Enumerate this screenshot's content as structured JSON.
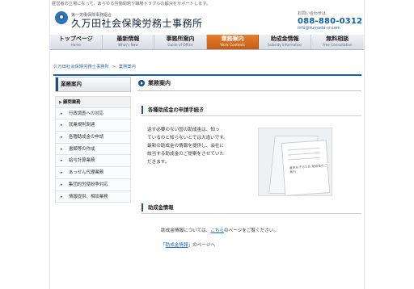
{
  "header": {
    "tagline": "経営者の立場になって、あらゆる労働問題や職場トラブルの解決をサポートします。",
    "logo_subtitle": "第一労働保険事務組合",
    "logo_title": "久万田社会保険労務士事務所",
    "contact_label": "お問い合わせは",
    "phone": "088-880-0312",
    "email": "info@kumada-sr.com"
  },
  "nav": {
    "items": [
      {
        "label": "トップページ",
        "en": "Home"
      },
      {
        "label": "最新情報",
        "en": "What's New"
      },
      {
        "label": "事務所案内",
        "en": "Guide of Office"
      },
      {
        "label": "業務案内",
        "en": "Work Contents"
      },
      {
        "label": "助成金情報",
        "en": "Subsidy Information"
      },
      {
        "label": "無料相談",
        "en": "Free Consultation"
      }
    ],
    "active": "業務案内"
  },
  "breadcrumb": {
    "home": "久万田社会保険労務士事務所",
    "separator": ">",
    "current": "業務案内"
  },
  "sidebar": {
    "title": "業務案内",
    "items": [
      {
        "label": "顧問業務"
      },
      {
        "label": "行政調査への対応"
      },
      {
        "label": "就業規則関連"
      },
      {
        "label": "各種助成金の申請"
      },
      {
        "label": "書類等の作成"
      },
      {
        "label": "給与計算業務"
      },
      {
        "label": "あっせん代理業務"
      },
      {
        "label": "集団的労使紛争対応"
      },
      {
        "label": "情報提供、相談業務"
      }
    ]
  },
  "main": {
    "title": "業務案内",
    "section1": {
      "heading": "各種助成金の申請手続き",
      "lines": [
        "返す必要のない国の助成金は、知っ",
        "ているのと知らないとでは大違いです。",
        "最新の助成金の情報を提供し、会社に",
        "該当する助成金のご提案をさせていた",
        "だきます。"
      ],
      "photo_text": "雇用を守るため\n助成金のご案内"
    },
    "section2": {
      "heading": "助成金情報",
      "line1_pre": "助成金情報については、",
      "line1_link": "こちら",
      "line1_post": "のページをご覧ください。",
      "line2_pre": "「",
      "line2_link": "助成金情報",
      "line2_post": "」のページへ"
    }
  },
  "colors": {
    "accent_blue": "#1b4f91",
    "nav_active_orange": "#d56c23",
    "link_blue": "#2368b3"
  }
}
